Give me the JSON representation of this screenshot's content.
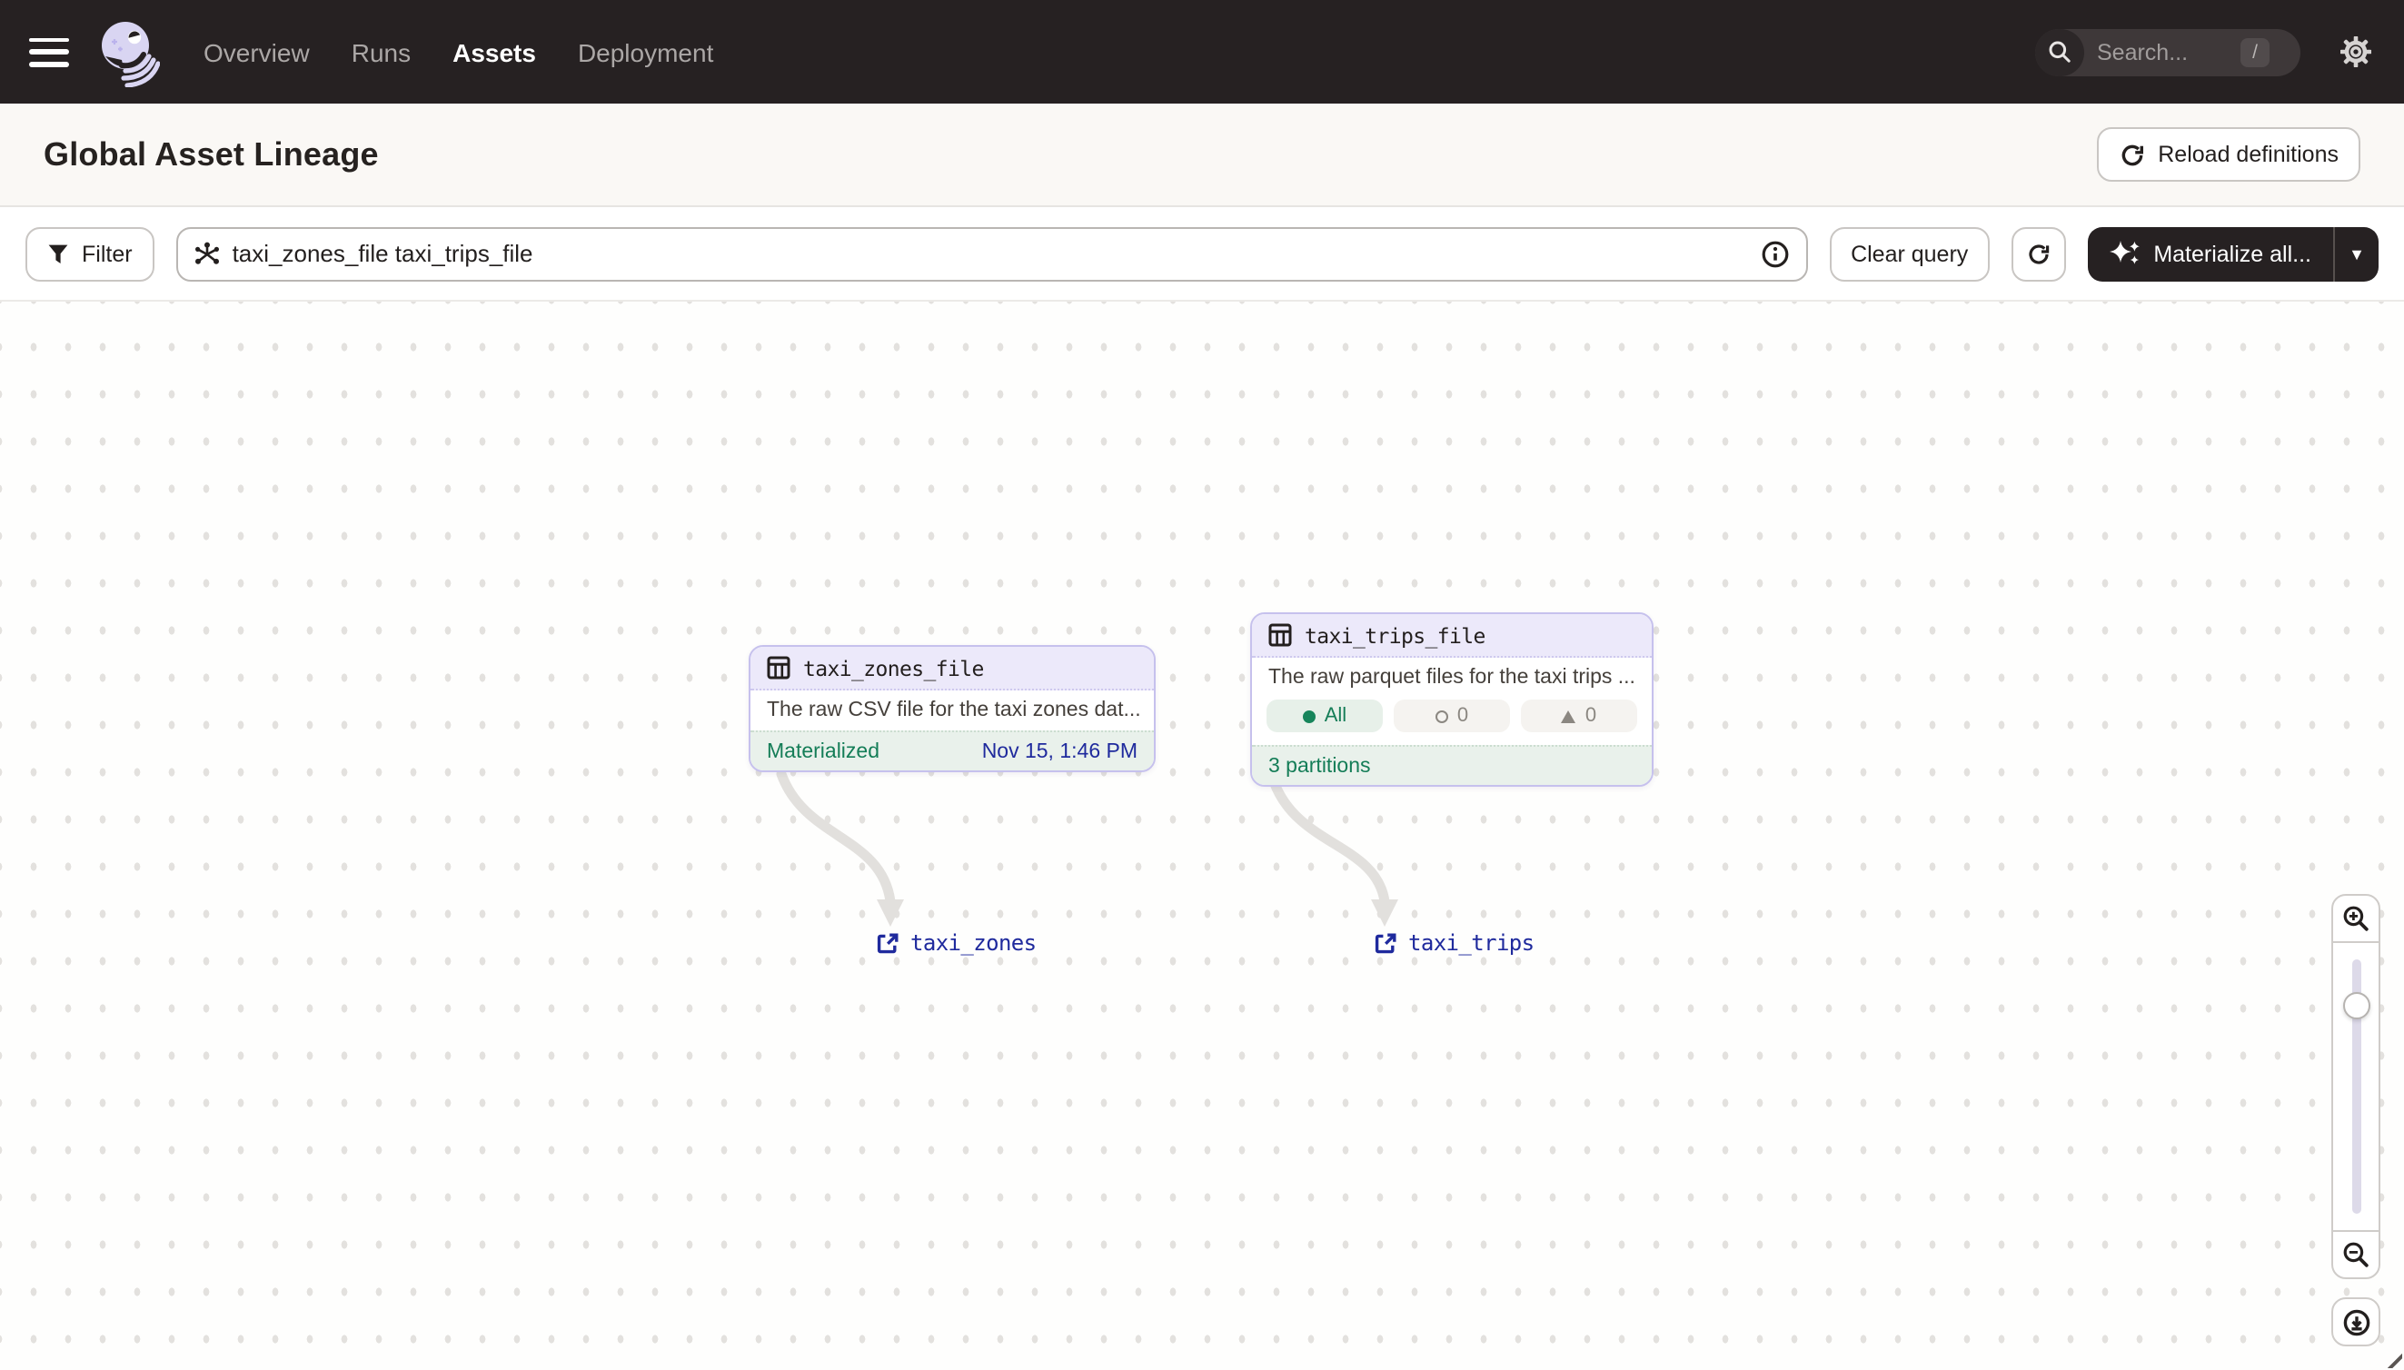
{
  "nav": {
    "items": [
      {
        "label": "Overview",
        "active": false
      },
      {
        "label": "Runs",
        "active": false
      },
      {
        "label": "Assets",
        "active": true
      },
      {
        "label": "Deployment",
        "active": false
      }
    ],
    "search": {
      "placeholder": "Search...",
      "shortcut_key": "/"
    }
  },
  "header": {
    "title": "Global Asset Lineage",
    "reload_label": "Reload definitions"
  },
  "toolbar": {
    "filter_label": "Filter",
    "query_value": "taxi_zones_file taxi_trips_file",
    "clear_label": "Clear query",
    "materialize_label": "Materialize all..."
  },
  "graph": {
    "nodes": [
      {
        "title": "taxi_zones_file",
        "description": "The raw CSV file for the taxi zones dat...",
        "status_label": "Materialized",
        "status_time": "Nov 15, 1:46 PM"
      },
      {
        "title": "taxi_trips_file",
        "description": "The raw parquet files for the taxi trips ...",
        "badges": [
          {
            "icon": "filled-circle",
            "label": "All"
          },
          {
            "icon": "outline-circle",
            "label": "0"
          },
          {
            "icon": "triangle",
            "label": "0"
          }
        ],
        "footer": "3 partitions"
      }
    ],
    "links": [
      {
        "label": "taxi_zones"
      },
      {
        "label": "taxi_trips"
      }
    ]
  },
  "colors": {
    "topnav_bg": "#262122",
    "accent_lavender": "#ECE9FA",
    "node_border": "#C6C1ED",
    "status_green": "#147D57",
    "link_navy": "#1F2A9D",
    "canvas_dot": "#E3E1DE",
    "dark_button_bg": "#262122"
  }
}
